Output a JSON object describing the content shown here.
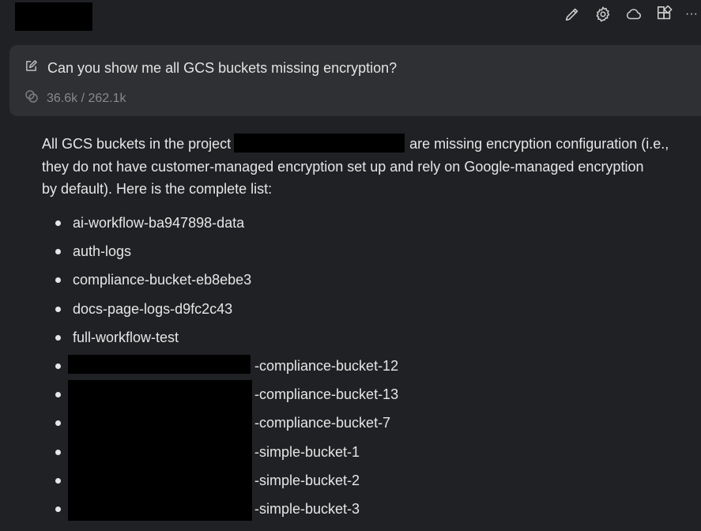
{
  "toolbar": {
    "icons": [
      "edit-pencil-icon",
      "gear-icon",
      "cloud-icon",
      "widgets-icon",
      "more-icon"
    ],
    "more_label": "···"
  },
  "prompt": {
    "text": "Can you show me all GCS buckets missing encryption?",
    "tokens": "36.6k / 262.1k"
  },
  "answer": {
    "line1_before": "All GCS buckets in the project",
    "line1_after": "are missing encryption configuration (i.e.,",
    "line2": "they do not have customer-managed encryption set up and rely on Google-managed encryption",
    "line3": "by default). Here is the complete list:",
    "buckets": [
      "ai-workflow-ba947898-data",
      "auth-logs",
      "compliance-bucket-eb8ebe3",
      "docs-page-logs-d9fc2c43",
      "full-workflow-test",
      "-compliance-bucket-12",
      "-compliance-bucket-13",
      "-compliance-bucket-7",
      "-simple-bucket-1",
      "-simple-bucket-2",
      "-simple-bucket-3"
    ]
  }
}
